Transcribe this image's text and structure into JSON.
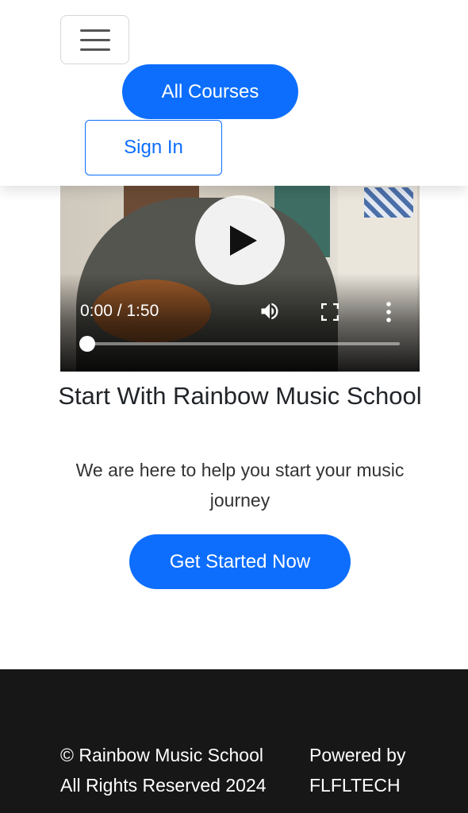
{
  "header": {
    "menu_icon": "hamburger-menu-icon",
    "all_courses_label": "All Courses",
    "sign_in_label": "Sign In"
  },
  "video": {
    "time_display": "0:00 / 1:50",
    "progress": 0,
    "icons": [
      "play-icon",
      "volume-icon",
      "fullscreen-icon",
      "more-options-icon"
    ]
  },
  "hero": {
    "title": "Start With Rainbow Music School",
    "subtitle": "We are here to help you start your music journey",
    "cta_label": "Get Started Now"
  },
  "footer": {
    "copyright_line1": "© Rainbow Music School",
    "copyright_line2": "All Rights Reserved 2024",
    "powered_line1": "Powered by",
    "powered_line2": "FLFLTECH"
  },
  "colors": {
    "primary": "#0d6efd",
    "footer_bg": "#171717",
    "text": "#212529"
  }
}
